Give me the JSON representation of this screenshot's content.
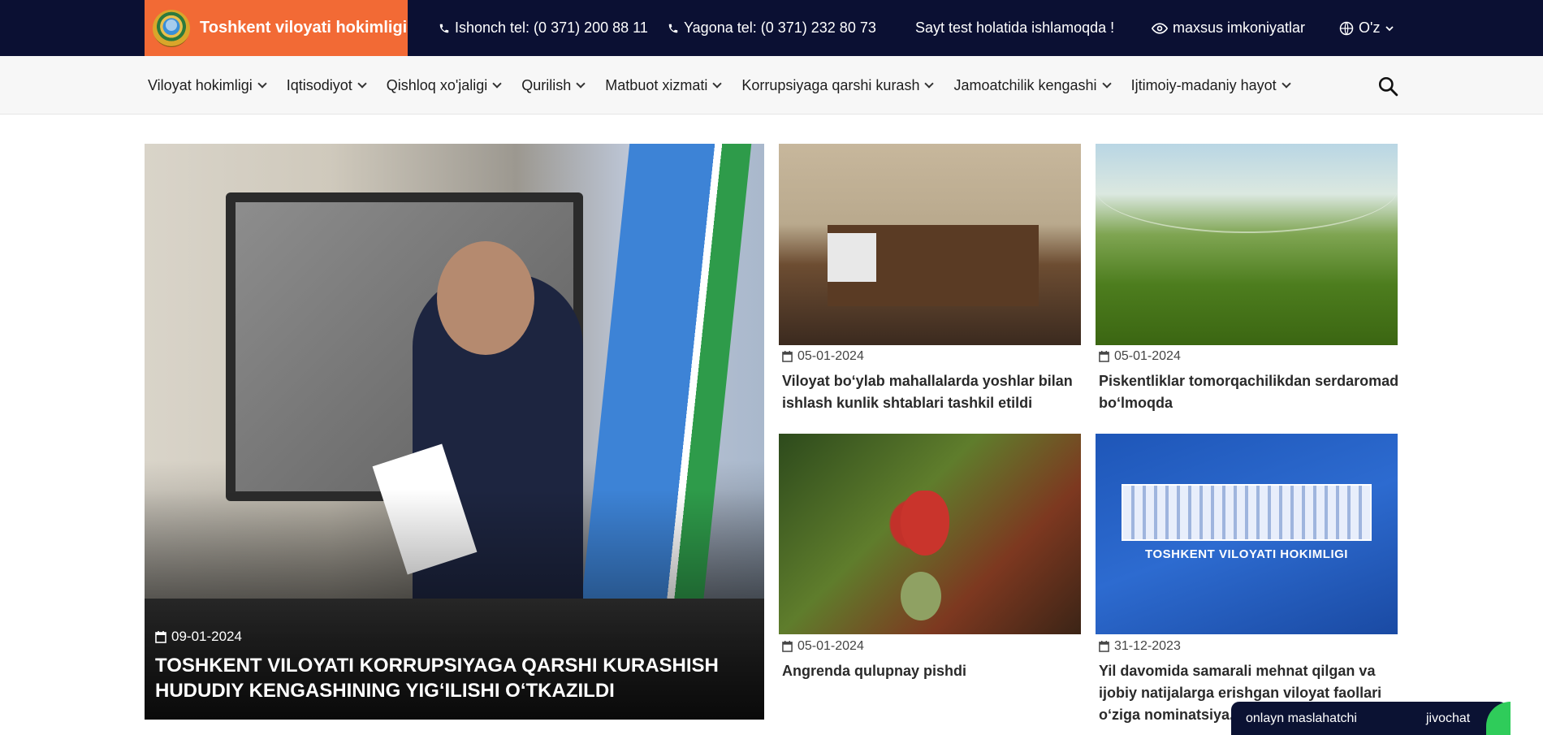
{
  "header": {
    "brand_name": "Toshkent viloyati hokimligi",
    "phone_trust": "Ishonch tel: (0 371) 200 88 11",
    "phone_single": "Yagona tel: (0 371) 232 80 73",
    "notice": "Sayt test holatida ishlamoqda !",
    "accessibility": "maxsus imkoniyatlar",
    "language": "O'z"
  },
  "nav": {
    "items": [
      "Viloyat hokimligi",
      "Iqtisodiyot",
      "Qishloq xo'jaligi",
      "Qurilish",
      "Matbuot xizmati",
      "Korrupsiyaga qarshi kurash",
      "Jamoatchilik kengashi",
      "Ijtimoiy-madaniy hayot"
    ]
  },
  "hero": {
    "date": "09-01-2024",
    "title": "TOSHKENT VILOYATI KORRUPSIYAGA QARSHI KURASHISH HUDUDIY KENGASHINING YIGʻILISHI OʻTKAZILDI"
  },
  "news": [
    {
      "date": "05-01-2024",
      "title": "Viloyat boʻylab mahallalarda yoshlar bilan ishlash kunlik shtablari tashkil etildi"
    },
    {
      "date": "05-01-2024",
      "title": "Piskentliklar tomorqachilikdan serdaromad boʻlmoqda"
    },
    {
      "date": "05-01-2024",
      "title": "Angrenda qulupnay pishdi"
    },
    {
      "date": "31-12-2023",
      "title": "Yil davomida samarali mehnat qilgan va ijobiy natijalarga erishgan viloyat faollari oʻziga nominatsiya..."
    }
  ],
  "news_image_text": "TOSHKENT VILOYATI HOKIMLIGI",
  "chat": {
    "label": "onlayn maslahatchi",
    "brand": "jivochat"
  },
  "colors": {
    "topbar": "#0b1033",
    "brand": "#f26a35",
    "nav_bg": "#f7f7f7"
  }
}
